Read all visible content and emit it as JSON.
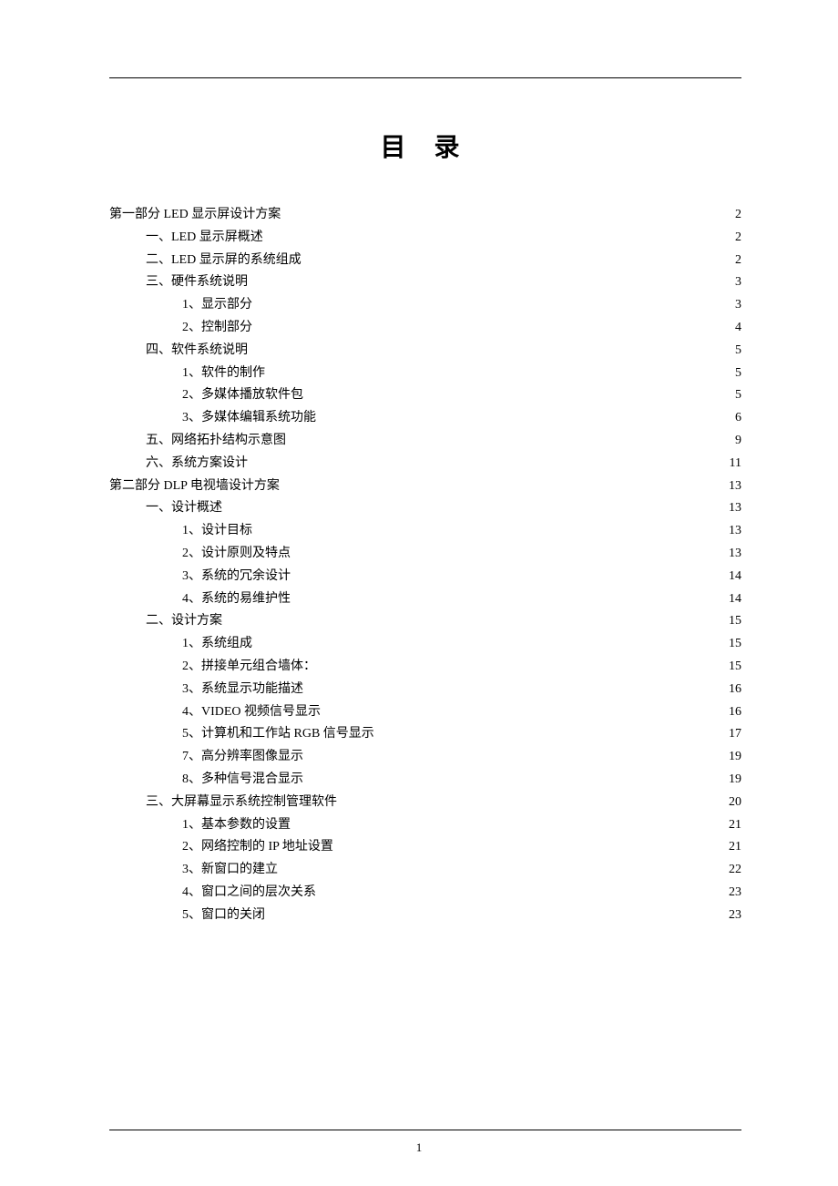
{
  "title": "目 录",
  "page_number": "1",
  "toc": [
    {
      "level": 0,
      "label": "第一部分  LED 显示屏设计方案",
      "page": "2"
    },
    {
      "level": 1,
      "label": "一、LED 显示屏概述",
      "page": "2"
    },
    {
      "level": 1,
      "label": "二、LED 显示屏的系统组成",
      "page": "2"
    },
    {
      "level": 1,
      "label": "三、硬件系统说明",
      "page": "3"
    },
    {
      "level": 2,
      "label": "1、显示部分",
      "page": "3"
    },
    {
      "level": 2,
      "label": "2、控制部分",
      "page": "4"
    },
    {
      "level": 1,
      "label": "四、软件系统说明",
      "page": "5"
    },
    {
      "level": 2,
      "label": "1、软件的制作",
      "page": "5"
    },
    {
      "level": 2,
      "label": "2、多媒体播放软件包",
      "page": "5"
    },
    {
      "level": 2,
      "label": "3、多媒体编辑系统功能",
      "page": "6"
    },
    {
      "level": 1,
      "label": "五、网络拓扑结构示意图",
      "page": "9"
    },
    {
      "level": 1,
      "label": "六、系统方案设计",
      "page": "11"
    },
    {
      "level": 0,
      "label": "第二部分  DLP 电视墙设计方案",
      "page": "13"
    },
    {
      "level": 1,
      "label": "一、设计概述",
      "page": "13"
    },
    {
      "level": 2,
      "label": "1、设计目标",
      "page": "13"
    },
    {
      "level": 2,
      "label": "2、设计原则及特点",
      "page": "13"
    },
    {
      "level": 2,
      "label": "3、系统的冗余设计",
      "page": "14"
    },
    {
      "level": 2,
      "label": "4、系统的易维护性",
      "page": "14"
    },
    {
      "level": 1,
      "label": "二、设计方案",
      "page": "15"
    },
    {
      "level": 2,
      "label": "1、系统组成",
      "page": "15"
    },
    {
      "level": 2,
      "label": "2、拼接单元组合墙体：",
      "page": "15"
    },
    {
      "level": 2,
      "label": "3、系统显示功能描述",
      "page": "16"
    },
    {
      "level": 2,
      "label": "4、VIDEO 视频信号显示",
      "page": "16"
    },
    {
      "level": 2,
      "label": "5、计算机和工作站 RGB 信号显示",
      "page": "17"
    },
    {
      "level": 2,
      "label": "7、高分辨率图像显示",
      "page": "19"
    },
    {
      "level": 2,
      "label": "8、多种信号混合显示",
      "page": "19"
    },
    {
      "level": 1,
      "label": "三、大屏幕显示系统控制管理软件",
      "page": "20"
    },
    {
      "level": 2,
      "label": "1、基本参数的设置",
      "page": "21"
    },
    {
      "level": 2,
      "label": "2、网络控制的 IP 地址设置",
      "page": "21"
    },
    {
      "level": 2,
      "label": "3、新窗口的建立",
      "page": "22"
    },
    {
      "level": 2,
      "label": "4、窗口之间的层次关系",
      "page": "23"
    },
    {
      "level": 2,
      "label": "5、窗口的关闭",
      "page": "23"
    }
  ]
}
